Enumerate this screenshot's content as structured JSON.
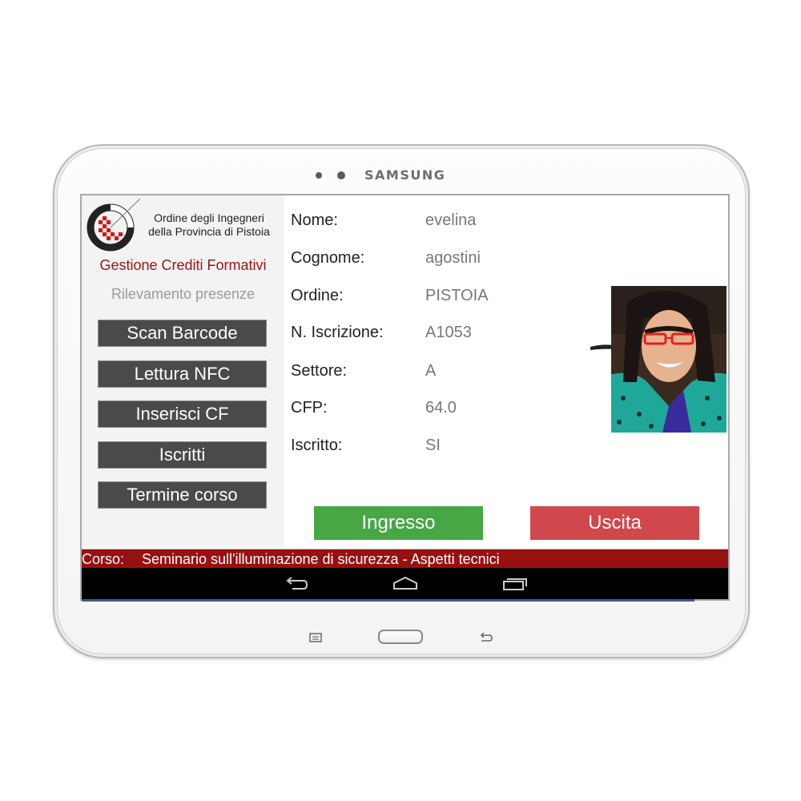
{
  "device": {
    "brand": "SAMSUNG"
  },
  "sidebar": {
    "org_name_line1": "Ordine degli Ingegneri",
    "org_name_line2": "della Provincia di Pistoia",
    "app_title": "Gestione Crediti Formativi",
    "app_subtitle": "Rilevamento presenze",
    "buttons": [
      {
        "label": "Scan Barcode"
      },
      {
        "label": "Lettura NFC"
      },
      {
        "label": "Inserisci CF"
      },
      {
        "label": "Iscritti"
      },
      {
        "label": "Termine corso"
      }
    ]
  },
  "member": {
    "fields": [
      {
        "label": "Nome:",
        "value": "evelina"
      },
      {
        "label": "Cognome:",
        "value": "agostini"
      },
      {
        "label": "Ordine:",
        "value": "PISTOIA"
      },
      {
        "label": "N. Iscrizione:",
        "value": "A1053"
      },
      {
        "label": "Settore:",
        "value": "A"
      },
      {
        "label": "CFP:",
        "value": "64.0"
      },
      {
        "label": "Iscritto:",
        "value": "SI"
      }
    ]
  },
  "actions": {
    "entry_label": "Ingresso",
    "exit_label": "Uscita"
  },
  "course": {
    "label": "Corso:",
    "name": "Seminario sull'illuminazione di sicurezza - Aspetti tecnici"
  },
  "colors": {
    "accent_red": "#981111",
    "entry_green": "#47a745",
    "exit_red": "#d0474c",
    "button_dark": "#4a4a4a"
  }
}
